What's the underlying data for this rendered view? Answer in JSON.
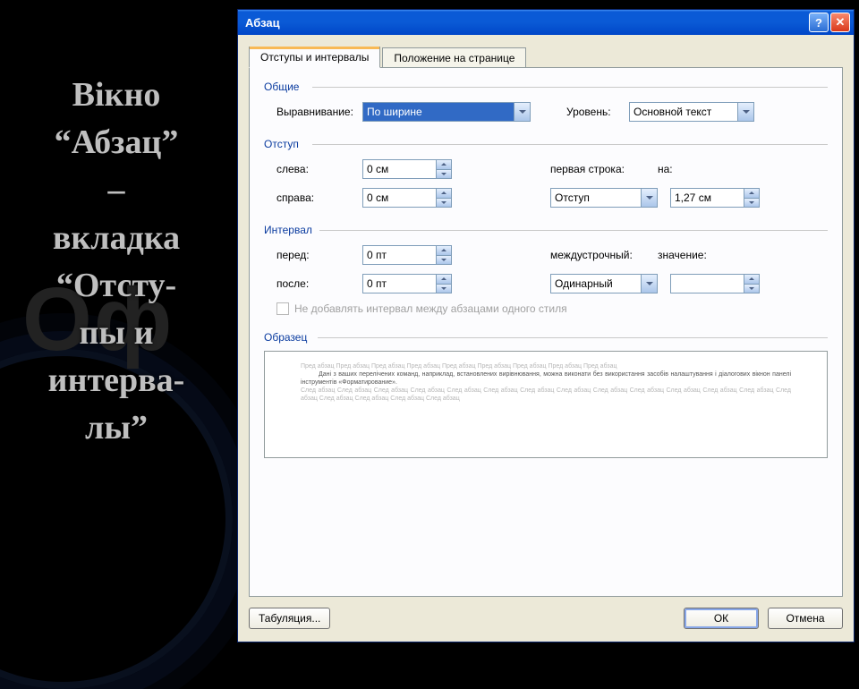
{
  "slide": {
    "watermark": "Оф",
    "text_lines": [
      "Вікно",
      "“Абзац”",
      "–",
      "вкладка",
      "“Отсту-",
      "пы и",
      "интерва-",
      "лы”"
    ]
  },
  "dialog": {
    "title": "Абзац",
    "tabs": {
      "indents": "Отступы и интервалы",
      "position": "Положение на странице"
    },
    "groups": {
      "general": "Общие",
      "indent": "Отступ",
      "interval": "Интервал",
      "sample": "Образец"
    },
    "labels": {
      "alignment": "Выравнивание:",
      "level": "Уровень:",
      "left": "слева:",
      "right": "справа:",
      "first_line": "первая строка:",
      "by": "на:",
      "before": "перед:",
      "after": "после:",
      "line_spacing": "междустрочный:",
      "value": "значение:",
      "no_space_checkbox": "Не добавлять интервал между абзацами одного стиля"
    },
    "values": {
      "alignment": "По ширине",
      "level": "Основной текст",
      "left": "0 см",
      "right": "0 см",
      "first_line": "Отступ",
      "by": "1,27 см",
      "before": "0 пт",
      "after": "0 пт",
      "line_spacing": "Одинарный",
      "value": ""
    },
    "buttons": {
      "tabs": "Табуляция...",
      "ok": "ОК",
      "cancel": "Отмена"
    },
    "preview": {
      "light1": "Пред абзац Пред абзац Пред абзац Пред абзац Пред абзац Пред абзац Пред абзац Пред абзац Пред абзац",
      "dark": "Дані з ваших перелічених команд, наприклад, встановлених вирівнювання, можна виконати без використання засобів налаштування і діалогових вікнон панелі інструментів «Форматирование».",
      "light2": "След абзац След абзац След абзац След абзац След абзац След абзац След абзац След абзац След абзац След абзац След абзац След абзац След абзац След абзац След абзац След абзац След абзац След абзац"
    }
  }
}
